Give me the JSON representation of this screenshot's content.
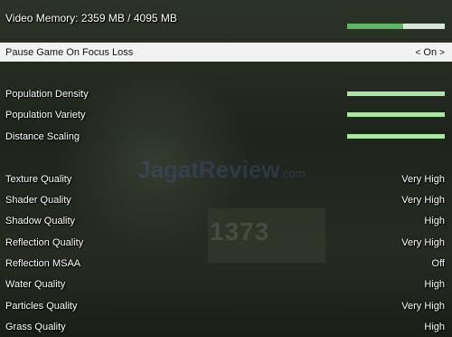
{
  "header": {
    "video_memory_label": "Video Memory: 2359 MB / 4095 MB",
    "memory_used_fraction": 0.576
  },
  "selected_setting": {
    "label": "Pause Game On Focus Loss",
    "value": "On",
    "left_arrow": "<",
    "right_arrow": ">"
  },
  "sliders": [
    {
      "label": "Population Density",
      "level": 1.0
    },
    {
      "label": "Population Variety",
      "level": 1.0
    },
    {
      "label": "Distance Scaling",
      "level": 1.0
    }
  ],
  "quality_settings": [
    {
      "label": "Texture Quality",
      "value": "Very High"
    },
    {
      "label": "Shader Quality",
      "value": "Very High"
    },
    {
      "label": "Shadow Quality",
      "value": "High"
    },
    {
      "label": "Reflection Quality",
      "value": "Very High"
    },
    {
      "label": "Reflection MSAA",
      "value": "Off"
    },
    {
      "label": "Water Quality",
      "value": "High"
    },
    {
      "label": "Particles Quality",
      "value": "Very High"
    },
    {
      "label": "Grass Quality",
      "value": "High"
    }
  ],
  "watermark": {
    "brand": "JagatReview",
    "suffix": ".com"
  },
  "background_number": "1373",
  "colors": {
    "memory_fill": "#5cb860",
    "slider_fill": "#a8e8a0",
    "selected_row_bg": "#f2f2f2"
  }
}
